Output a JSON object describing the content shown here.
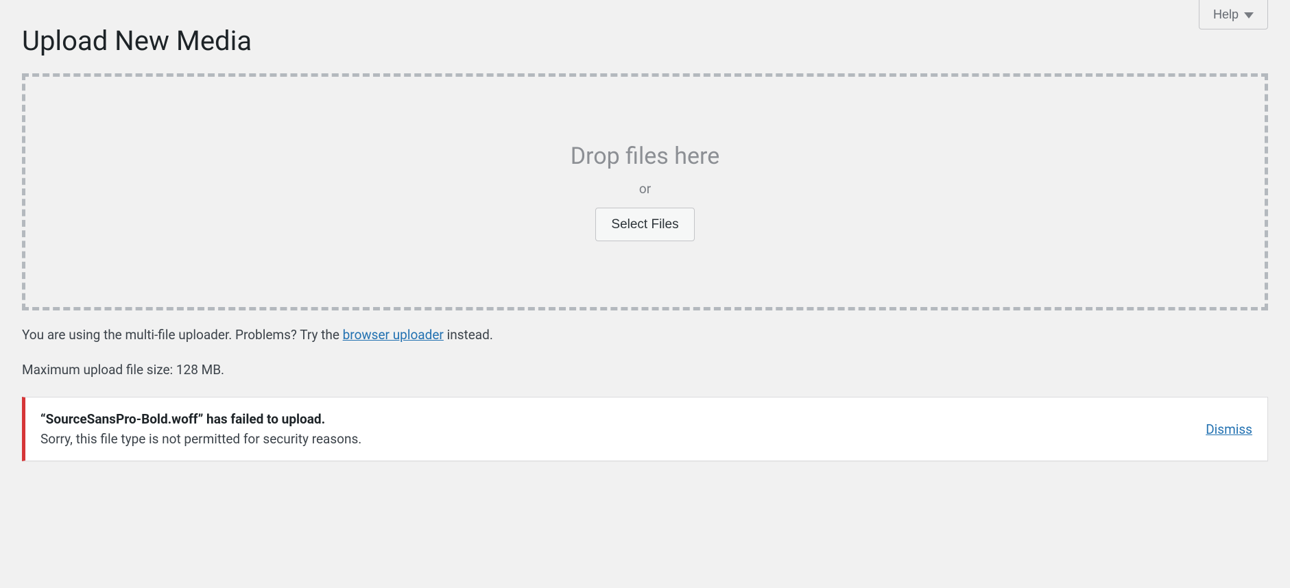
{
  "header": {
    "help_label": "Help"
  },
  "page": {
    "title": "Upload New Media"
  },
  "uploader": {
    "drop_title": "Drop files here",
    "or_label": "or",
    "select_button": "Select Files",
    "info_prefix": "You are using the multi-file uploader. Problems? Try the ",
    "browser_link_label": "browser uploader",
    "info_suffix": " instead.",
    "max_size_text": "Maximum upload file size: 128 MB."
  },
  "error": {
    "filename": "“SourceSansPro-Bold.woff”",
    "headline_suffix": " has failed to upload.",
    "body": "Sorry, this file type is not permitted for security reasons.",
    "dismiss_label": "Dismiss"
  }
}
